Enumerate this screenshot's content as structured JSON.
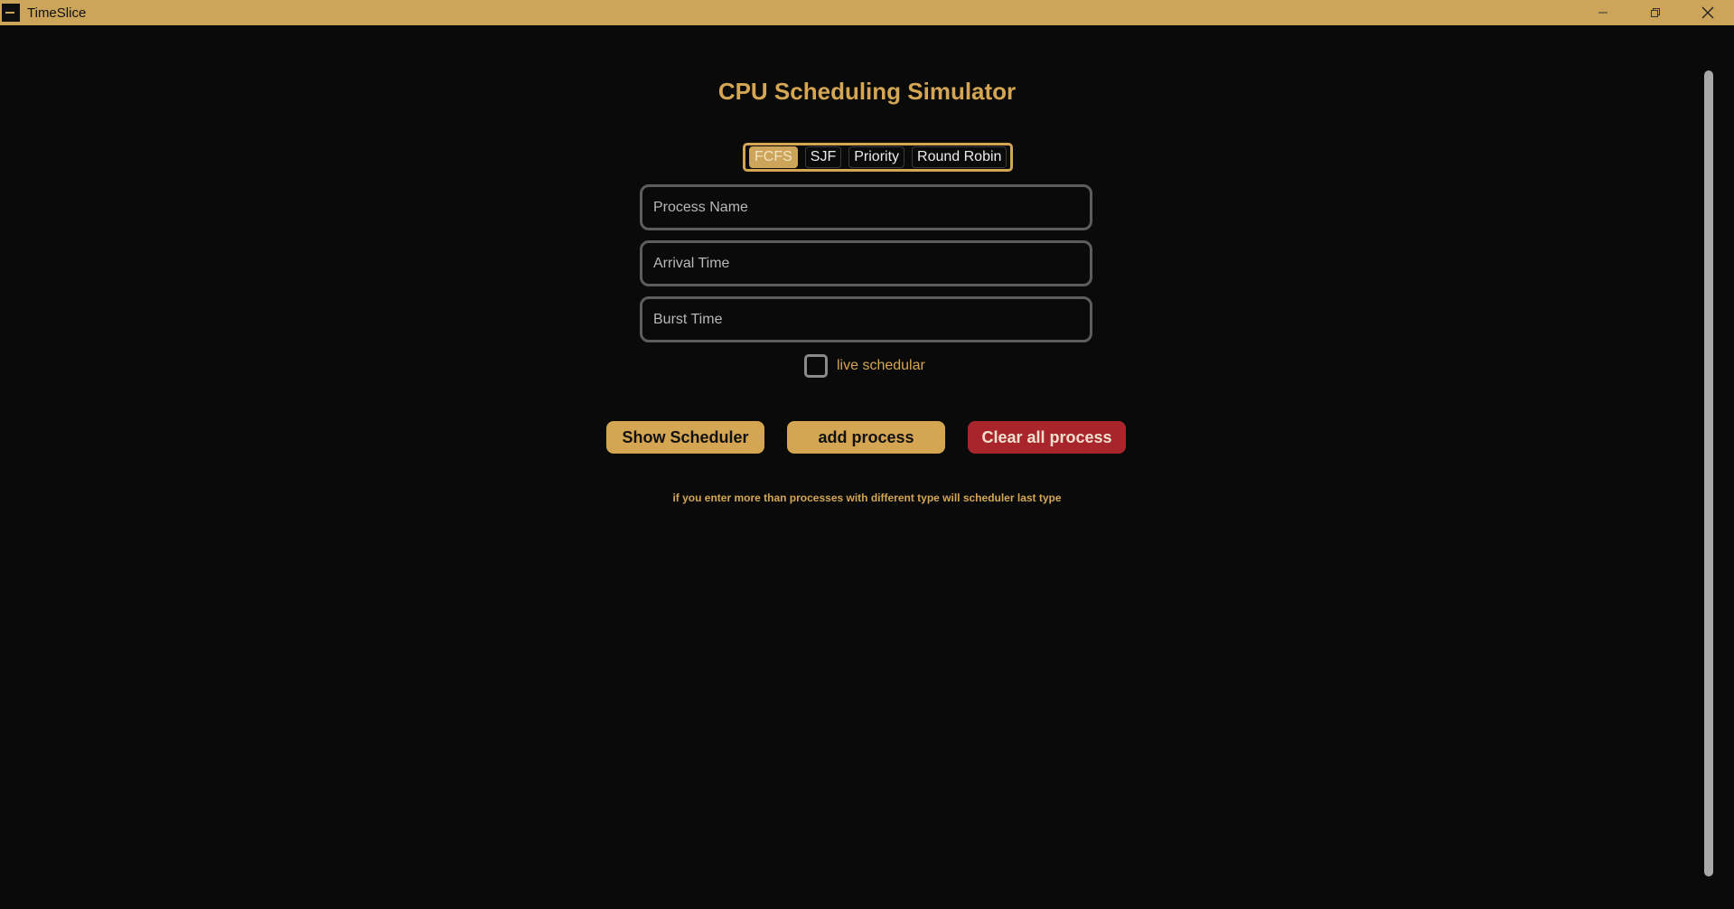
{
  "window": {
    "title": "TimeSlice",
    "controls": [
      "minimize-icon",
      "restore-icon",
      "close-icon"
    ]
  },
  "colors": {
    "accent": "#d4a653",
    "titlebar": "#cda55a",
    "danger": "#a8262b",
    "background": "#0a0a0a"
  },
  "main": {
    "title": "CPU Scheduling Simulator",
    "tabs": [
      {
        "label": "FCFS",
        "active": true
      },
      {
        "label": "SJF",
        "active": false
      },
      {
        "label": "Priority",
        "active": false
      },
      {
        "label": "Round Robin",
        "active": false
      }
    ],
    "fields": {
      "process_name": {
        "placeholder": "Process Name",
        "value": ""
      },
      "arrival_time": {
        "placeholder": "Arrival Time",
        "value": ""
      },
      "burst_time": {
        "placeholder": "Burst Time",
        "value": ""
      }
    },
    "live_scheduler": {
      "label": "live schedular",
      "checked": false
    },
    "buttons": {
      "show": "Show Scheduler",
      "add": "add process",
      "clear": "Clear all process"
    },
    "note": "if you enter more than processes with different type will scheduler last type"
  }
}
